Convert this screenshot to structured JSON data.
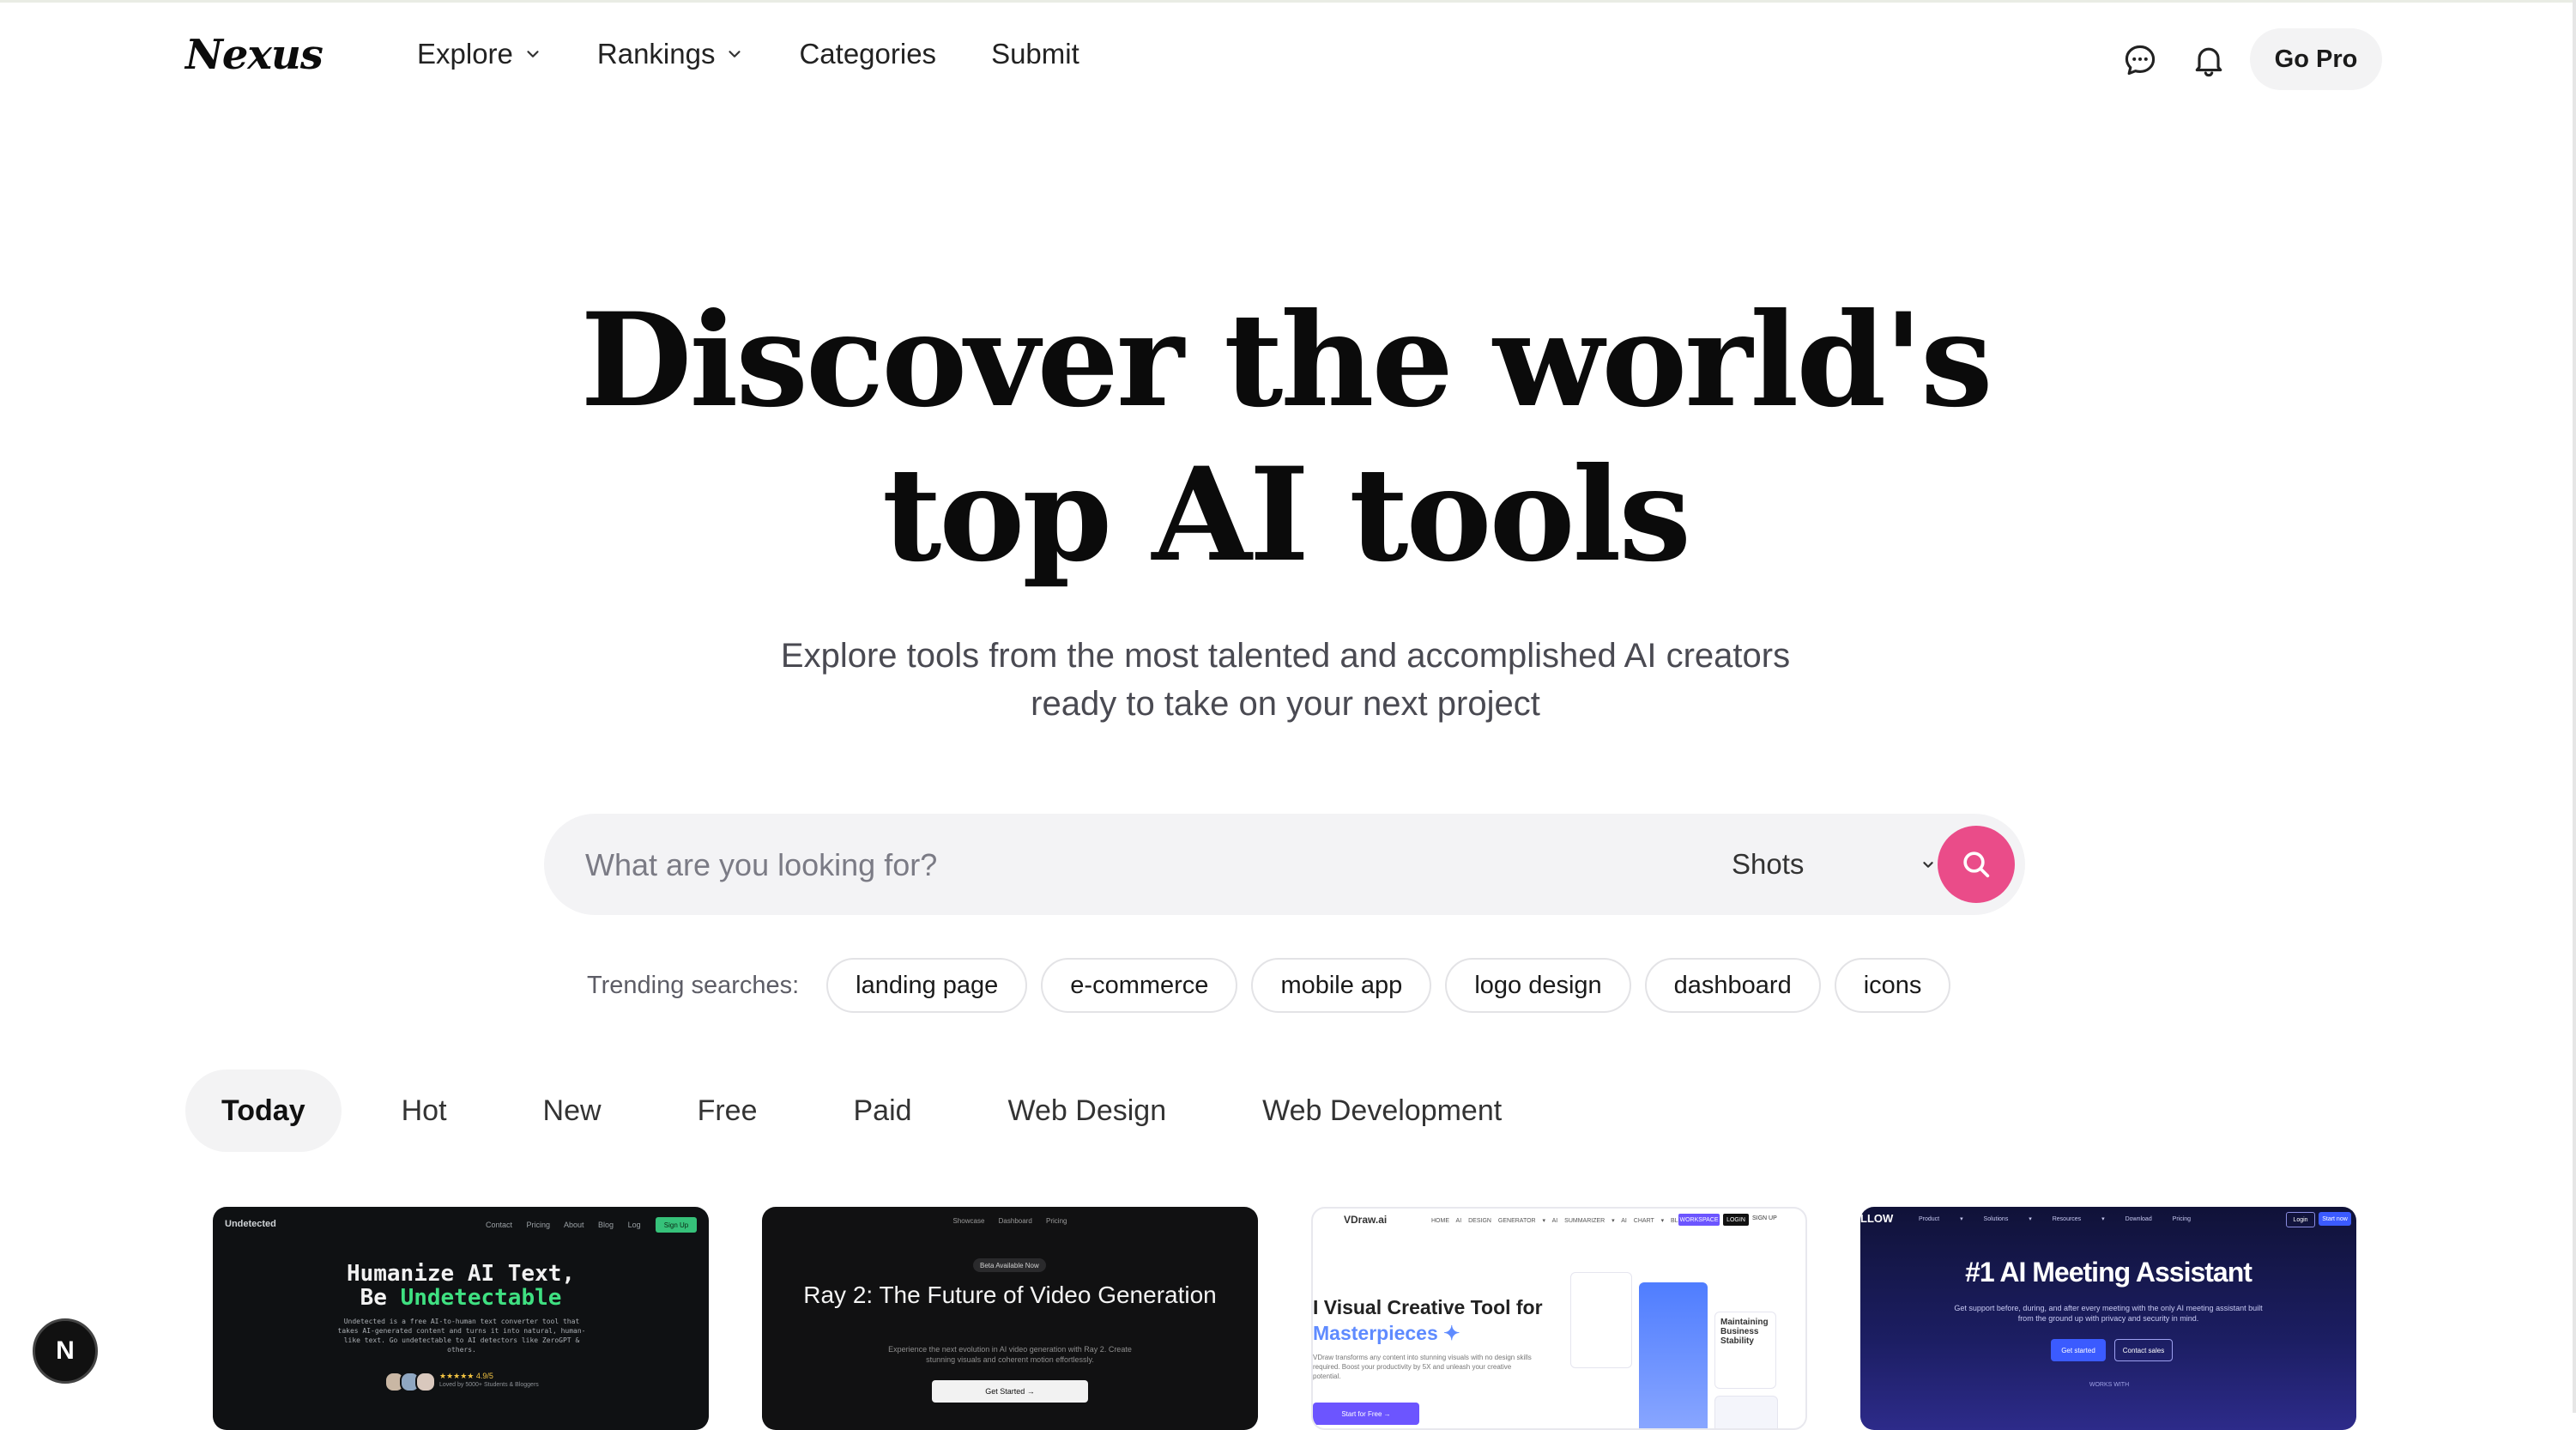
{
  "header": {
    "logo": "Nexus",
    "nav": [
      {
        "label": "Explore",
        "dropdown": true
      },
      {
        "label": "Rankings",
        "dropdown": true
      },
      {
        "label": "Categories",
        "dropdown": false
      },
      {
        "label": "Submit",
        "dropdown": false
      }
    ],
    "icons": [
      "message-icon",
      "bell-icon"
    ],
    "cta_label": "Go Pro"
  },
  "hero": {
    "title_line1": "Discover the world's",
    "title_line2": "top AI tools",
    "subtitle_line1": "Explore tools from the most talented and accomplished AI creators",
    "subtitle_line2": "ready to take on your next project"
  },
  "search": {
    "placeholder": "What are you looking for?",
    "value": "",
    "scope_selected": "Shots"
  },
  "trending": {
    "label": "Trending searches:",
    "items": [
      "landing page",
      "e-commerce",
      "mobile app",
      "logo design",
      "dashboard",
      "icons"
    ]
  },
  "filters": {
    "tabs": [
      "Today",
      "Hot",
      "New",
      "Free",
      "Paid",
      "Web Design",
      "Web Development"
    ],
    "active": "Today"
  },
  "cards": [
    {
      "brand": "Undetected",
      "nav": "Contact Pricing About Blog Log In",
      "cta": "Sign Up",
      "headline1": "Humanize AI Text,",
      "headline2_prefix": "Be ",
      "headline2_accent": "Undetectable",
      "body": "Undetected is a free AI-to-human text converter tool that takes AI-generated content and turns it into natural, human-like text. Go undetectable to AI detectors like ZeroGPT & others.",
      "rating": "★★★★★ 4.9/5",
      "loved": "Loved by 5000+ Students & Bloggers"
    },
    {
      "nav": "Showcase Dashboard Pricing",
      "badge": "Beta Available Now",
      "headline": "Ray 2: The Future of Video Generation",
      "body": "Experience the next evolution in AI video generation with Ray 2. Create stunning visuals and coherent motion effortlessly.",
      "cta": "Get Started →"
    },
    {
      "brand": "VDraw.ai",
      "nav": "HOME  AI DESIGN GENERATOR ▾  AI SUMMARIZER ▾  AI CHART ▾  BLOG",
      "workspace": "WORKSPACE",
      "login": "LOGIN",
      "signup": "SIGN UP",
      "headline1": "I Visual Creative Tool for",
      "headline2": "Masterpieces ✦",
      "body": "VDraw transforms any content into stunning visuals with no design skills required. Boost your productivity by 5X and unleash your creative potential.",
      "cta": "Start for Free →",
      "mock_label": "Maintaining Business Stability"
    },
    {
      "brand": "LLOW",
      "nav": "Product ▾ Solutions ▾ Resources ▾ Download Pricing",
      "login": "Login",
      "start": "Start now",
      "headline": "#1 AI Meeting Assistant",
      "body": "Get support before, during, and after every meeting with the only AI meeting assistant built from the ground up with privacy and security in mind.",
      "btn1": "Get started",
      "btn2": "Contact sales",
      "works": "WORKS WITH"
    }
  ],
  "dev_indicator": "N",
  "colors": {
    "accent": "#ea4c89",
    "text": "#111111",
    "muted": "#5d5d66",
    "pill_bg": "#f3f3f4"
  }
}
